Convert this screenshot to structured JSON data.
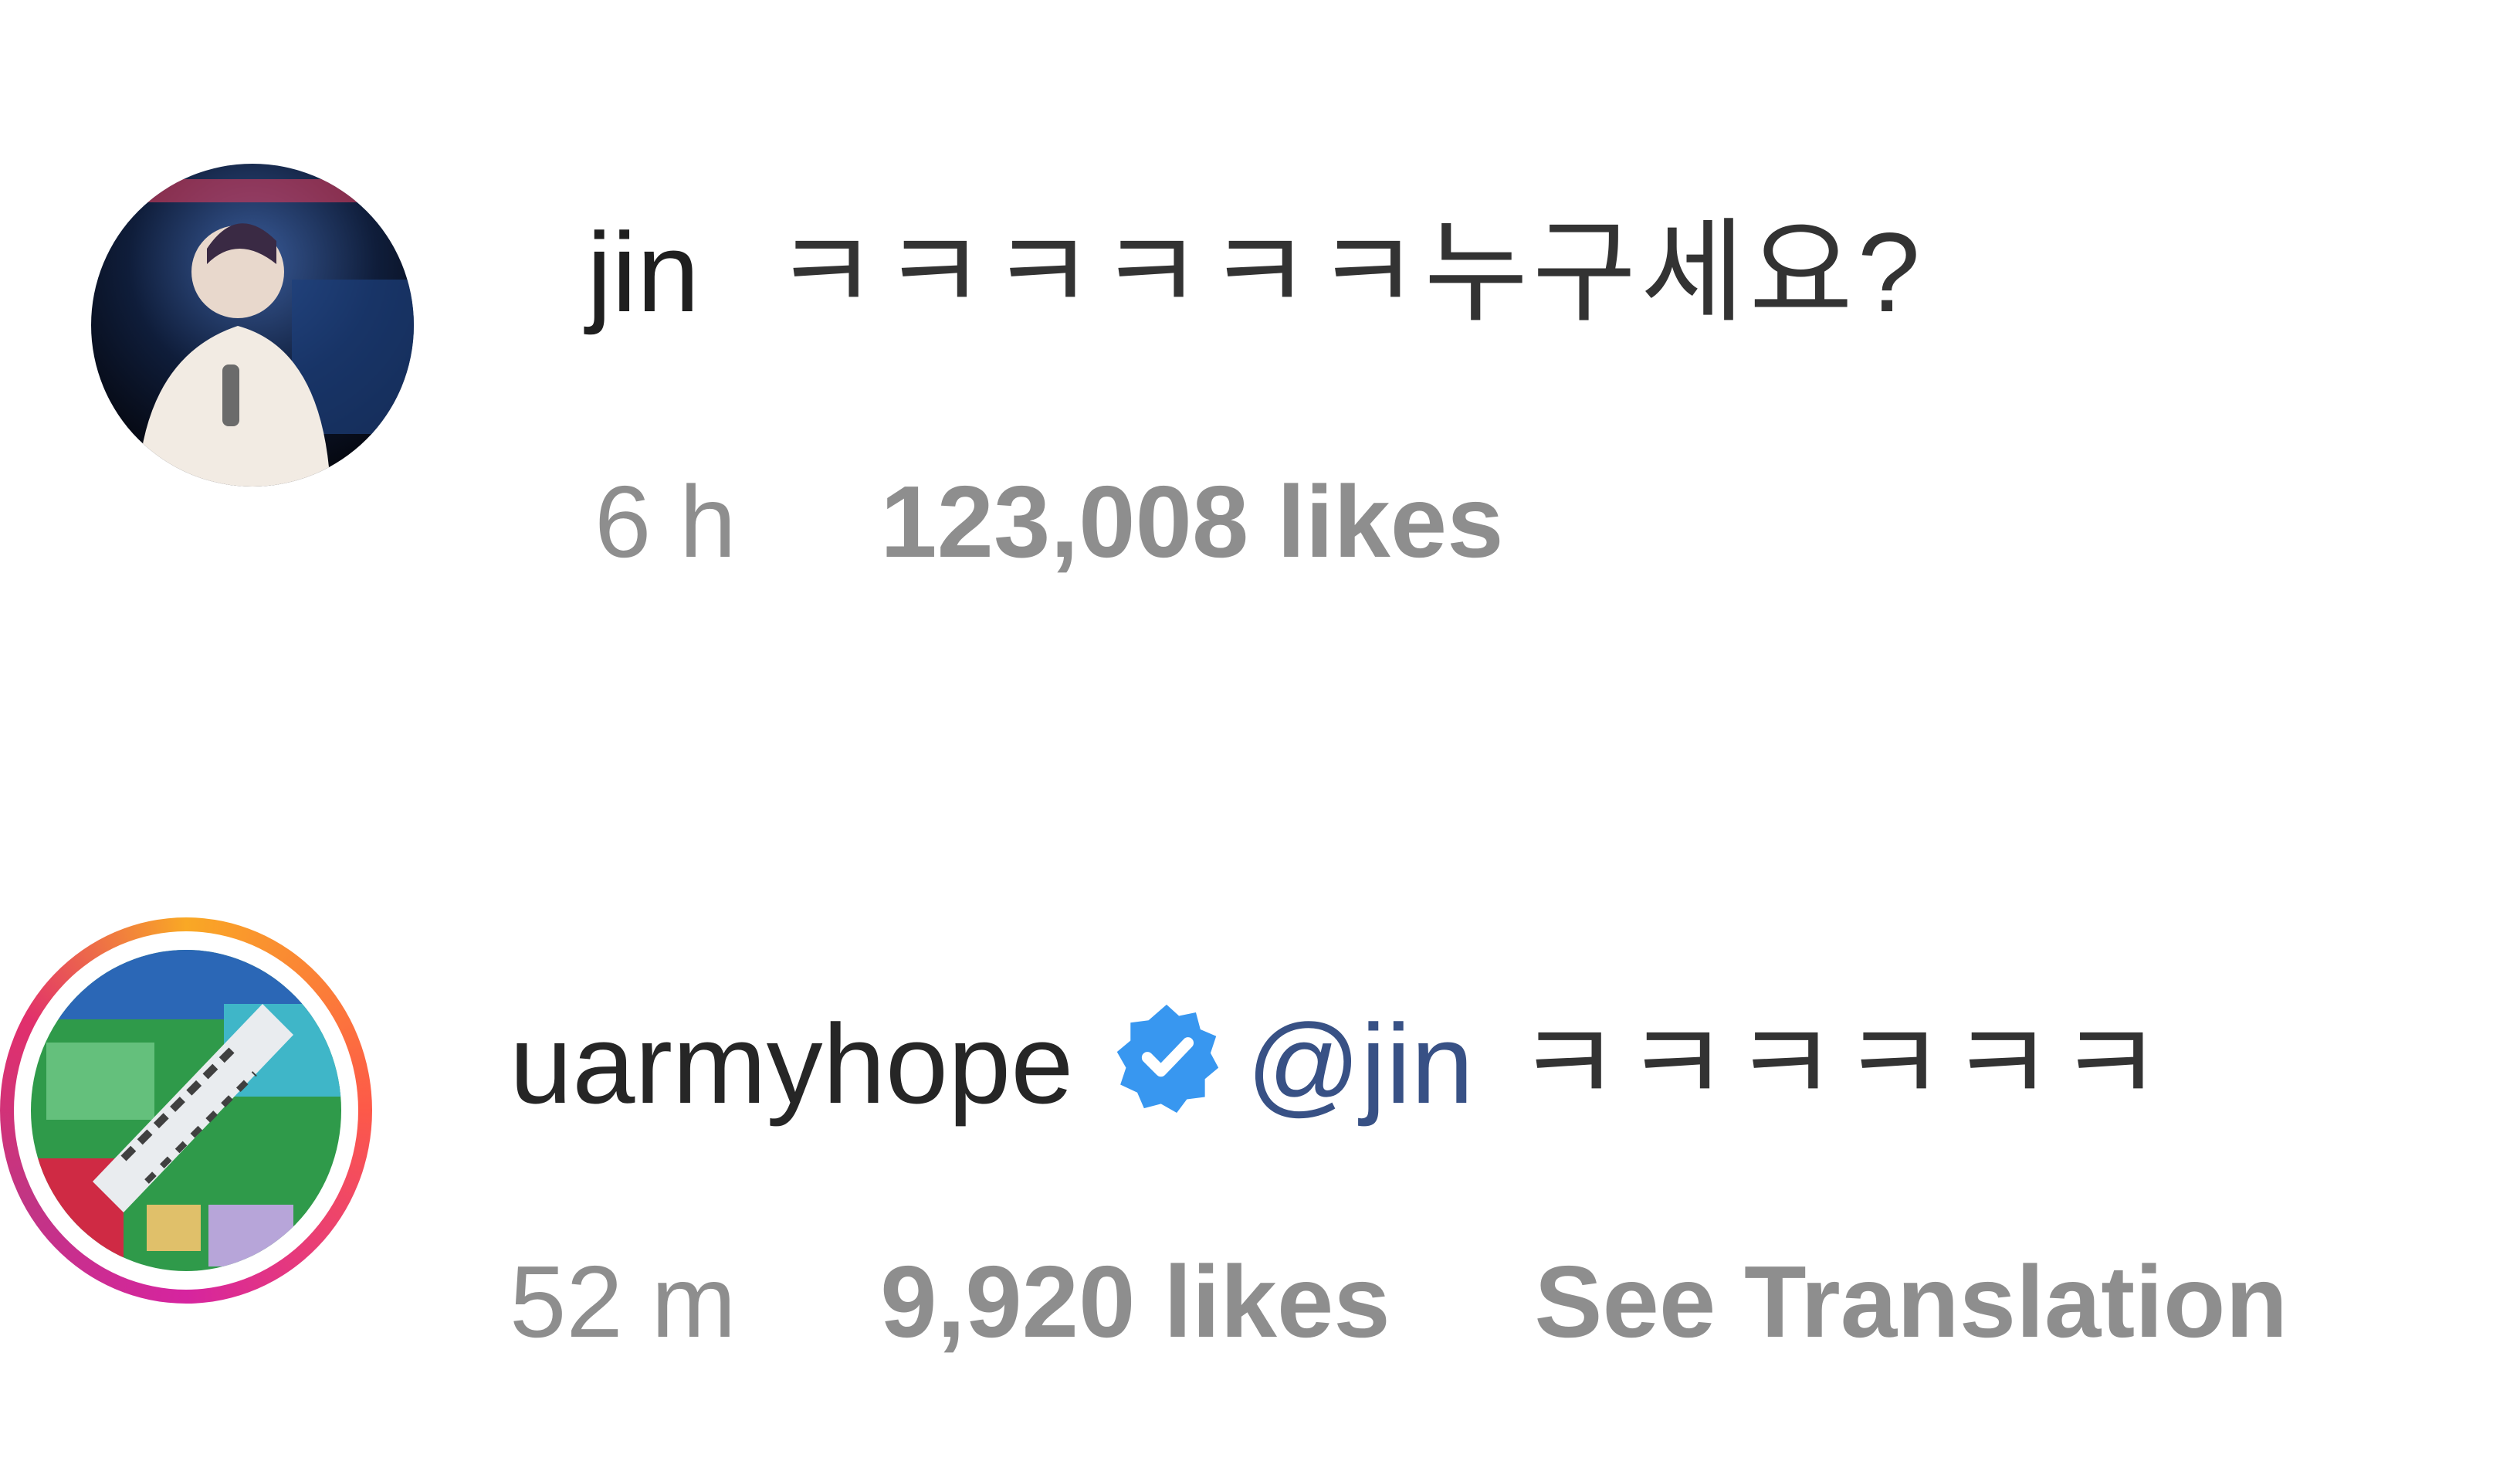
{
  "comments": [
    {
      "username": "jin",
      "text": "ㅋㅋㅋㅋㅋㅋ누구세요?",
      "time": "6 h",
      "likes": "123,008 likes"
    },
    {
      "username": "uarmyhope",
      "verified_icon": "verified-badge-icon",
      "mention": "@jin",
      "text": "ㅋㅋㅋㅋㅋㅋ",
      "time": "52 m",
      "likes": "9,920 likes",
      "see_translation": "See Translation"
    }
  ],
  "colors": {
    "text": "#262626",
    "meta": "#8e8e8e",
    "mention": "#385185",
    "verified": "#3897f0"
  }
}
